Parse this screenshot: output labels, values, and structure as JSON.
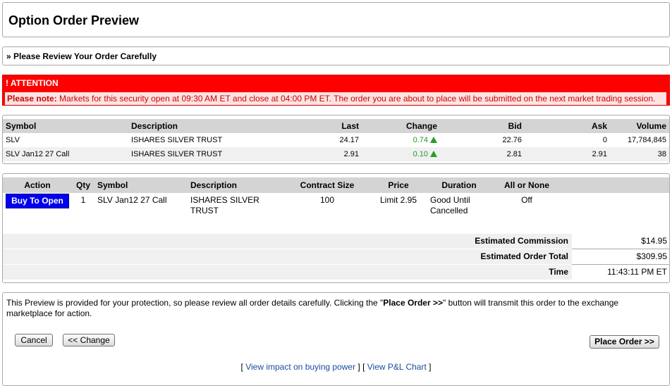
{
  "page": {
    "title": "Option Order Preview",
    "review_text": "» Please Review Your Order Carefully"
  },
  "attention": {
    "heading": "! ATTENTION",
    "note_label": "Please note:",
    "note_text": " Markets for this security open at 09:30 AM ET and close at 04:00 PM ET. The order you are about to place will be submitted on the next market trading session."
  },
  "quotes": {
    "headers": {
      "symbol": "Symbol",
      "description": "Description",
      "last": "Last",
      "change": "Change",
      "bid": "Bid",
      "ask": "Ask",
      "volume": "Volume"
    },
    "rows": [
      {
        "symbol": "SLV",
        "description": "ISHARES SILVER TRUST",
        "last": "24.17",
        "change": "0.74",
        "bid": "22.76",
        "ask": "0",
        "volume": "17,784,845"
      },
      {
        "symbol": "SLV Jan12 27 Call",
        "description": "ISHARES SILVER TRUST",
        "last": "2.91",
        "change": "0.10",
        "bid": "2.81",
        "ask": "2.91",
        "volume": "38"
      }
    ]
  },
  "order": {
    "headers": {
      "action": "Action",
      "qty": "Qty",
      "symbol": "Symbol",
      "description": "Description",
      "contract_size": "Contract Size",
      "price": "Price",
      "duration": "Duration",
      "aon": "All or None"
    },
    "row": {
      "action": "Buy To Open",
      "qty": "1",
      "symbol": "SLV Jan12 27 Call",
      "description": "ISHARES SILVER TRUST",
      "contract_size": "100",
      "price": "Limit 2.95",
      "duration": "Good Until Cancelled",
      "aon": "Off"
    },
    "totals": {
      "commission_label": "Estimated Commission",
      "commission": "$14.95",
      "total_label": "Estimated Order Total",
      "total": "$309.95",
      "time_label": "Time",
      "time": "11:43:11 PM ET"
    }
  },
  "footer": {
    "msg_pre": "This Preview is provided for your protection, so please review all order details carefully. Clicking the \"",
    "msg_bold": "Place Order >>",
    "msg_post": "\" button will transmit this order to the exchange marketplace for action.",
    "cancel_label": "Cancel",
    "change_label": "<< Change",
    "place_label": "Place Order >>",
    "link_open": "[ ",
    "link1": "View impact on buying power",
    "link_mid": " ] [ ",
    "link2": "View P&L Chart",
    "link_close": " ]"
  },
  "colors": {
    "attention_bg": "#ff0000",
    "note_bg": "#fde4e4",
    "action_button": "#0000ee",
    "up_green": "#2a9a2a",
    "link": "#1a4c9c"
  },
  "icons": {
    "change_indicator": "up-triangle-icon"
  }
}
